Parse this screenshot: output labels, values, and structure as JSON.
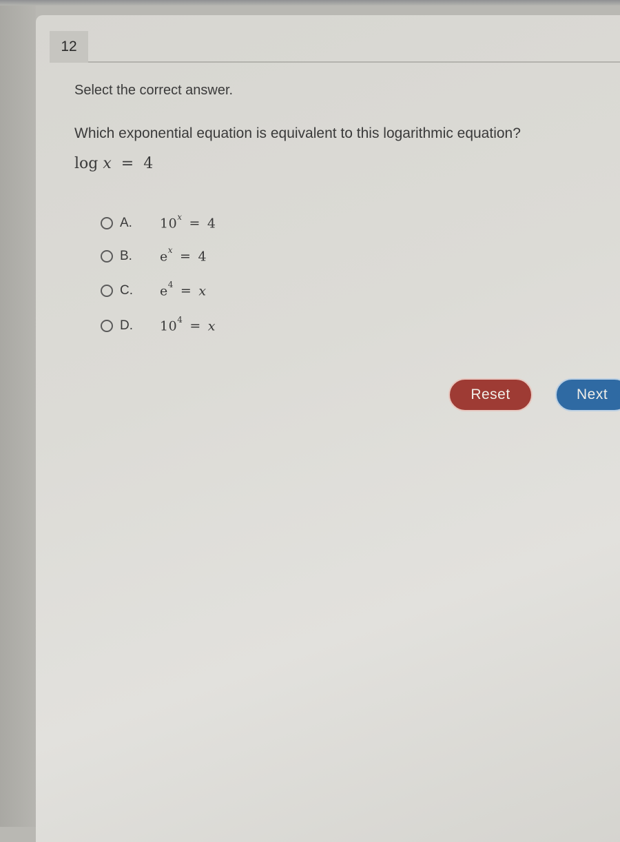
{
  "question": {
    "number": "12",
    "instruction": "Select the correct answer.",
    "prompt": "Which exponential equation is equivalent to this logarithmic equation?",
    "given_equation": {
      "func": "log",
      "variable": "x",
      "equals": "=",
      "value": "4"
    }
  },
  "options": [
    {
      "letter": "A.",
      "base": "10",
      "exponent": "x",
      "equals": "=",
      "rhs": "4",
      "selected": false
    },
    {
      "letter": "B.",
      "base": "e",
      "exponent": "x",
      "equals": "=",
      "rhs": "4",
      "selected": false
    },
    {
      "letter": "C.",
      "base": "e",
      "exponent": "4",
      "equals": "=",
      "rhs": "x",
      "selected": false
    },
    {
      "letter": "D.",
      "base": "10",
      "exponent": "4",
      "equals": "=",
      "rhs": "x",
      "selected": false
    }
  ],
  "buttons": {
    "reset_label": "Reset",
    "next_label": "Next"
  },
  "colors": {
    "reset": "#9e3b34",
    "next": "#2f6aa3",
    "background": "#dcdbd6"
  }
}
